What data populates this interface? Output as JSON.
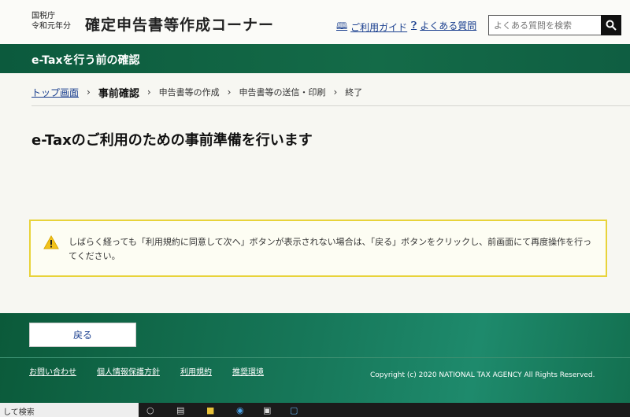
{
  "header": {
    "agency_line1": "国税庁",
    "agency_line2": "令和元年分",
    "site_title": "確定申告書等作成コーナー",
    "guide_link": "ご利用ガイド",
    "faq_link": "よくある質問",
    "search_placeholder": "よくある質問を検索"
  },
  "section_bar": {
    "title": "e-Taxを行う前の確認"
  },
  "breadcrumb": {
    "home": "トップ画面",
    "current": "事前確認",
    "steps": [
      "申告書等の作成",
      "申告書等の送信・印刷",
      "終了"
    ]
  },
  "main": {
    "title": "e-Taxのご利用のための事前準備を行います",
    "warning_text": "しばらく経っても「利用規約に同意して次へ」ボタンが表示されない場合は、「戻る」ボタンをクリックし、前画面にて再度操作を行ってください。"
  },
  "footer": {
    "back_button": "戻る",
    "links": [
      "お問い合わせ",
      "個人情報保護方針",
      "利用規約",
      "推奨環境"
    ],
    "copyright": "Copyright (c) 2020 NATIONAL TAX AGENCY All Rights Reserved."
  },
  "taskbar": {
    "search_text": "して検索"
  },
  "colors": {
    "brand_green": "#0c5a3d",
    "link_blue": "#1a3f8f",
    "warning_border": "#e8d33a"
  }
}
